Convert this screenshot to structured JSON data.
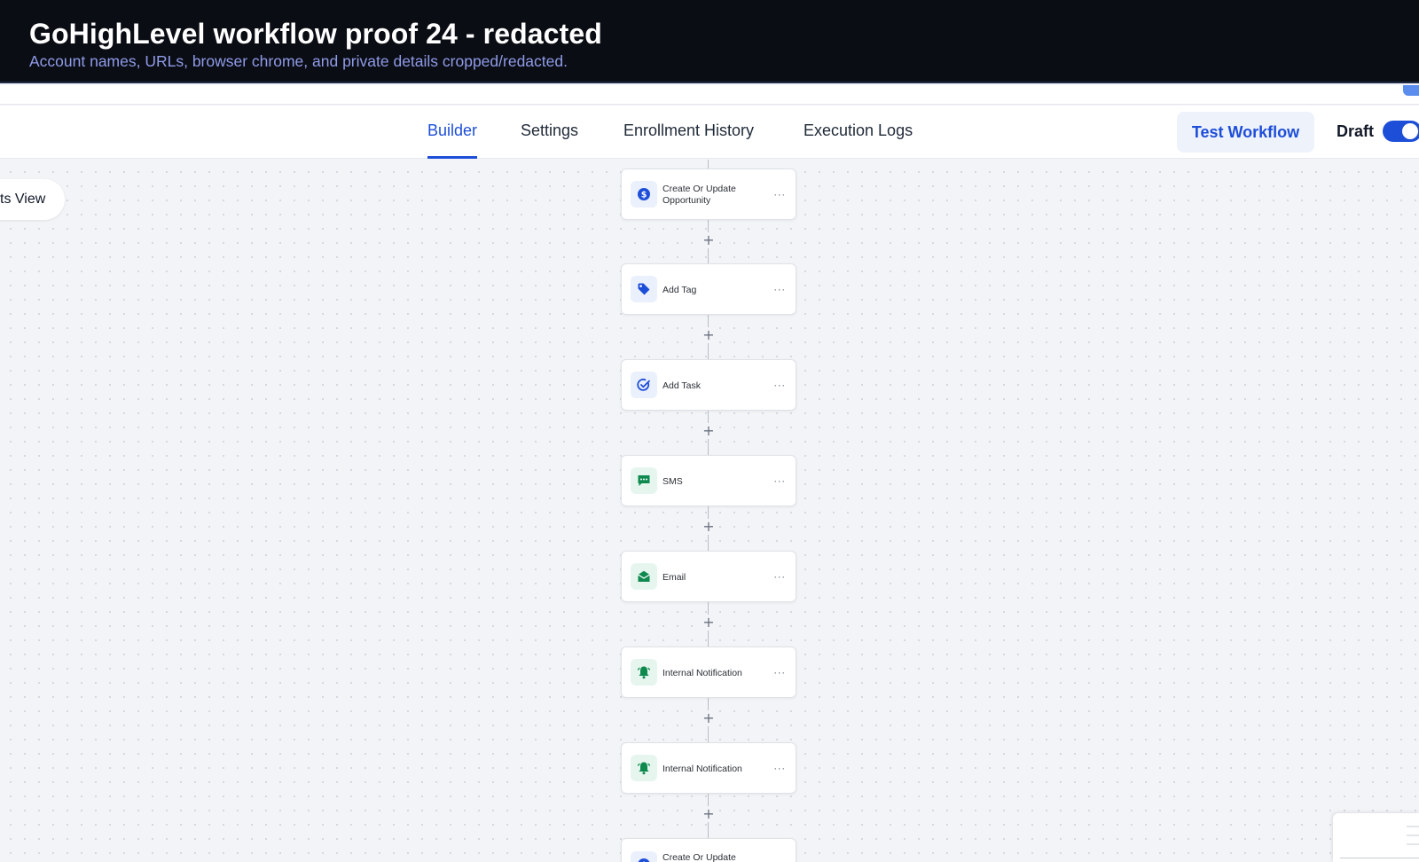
{
  "banner": {
    "title": "GoHighLevel workflow proof 24 - redacted",
    "subtitle": "Account names, URLs, browser chrome, and private details cropped/redacted."
  },
  "tabs": {
    "builder": "Builder",
    "settings": "Settings",
    "enrollment": "Enrollment History",
    "logs": "Execution Logs",
    "active": "Builder"
  },
  "toolbar": {
    "test_workflow": "Test Workflow",
    "status_label": "Draft",
    "status_toggle_on": true
  },
  "canvas": {
    "view_pill": "ts View",
    "add_step_symbol": "+",
    "node_menu_symbol": "···",
    "nodes": [
      {
        "label": "Create Or Update Opportunity",
        "icon": "dollar-icon",
        "color": "#1d4ed8"
      },
      {
        "label": "Add Tag",
        "icon": "tag-icon",
        "color": "#1d4ed8"
      },
      {
        "label": "Add Task",
        "icon": "task-check-icon",
        "color": "#1d4ed8"
      },
      {
        "label": "SMS",
        "icon": "sms-icon",
        "color": "#0f8a4f"
      },
      {
        "label": "Email",
        "icon": "email-icon",
        "color": "#0f8a4f"
      },
      {
        "label": "Internal Notification",
        "icon": "bell-icon",
        "color": "#0f8a4f"
      },
      {
        "label": "Internal Notification",
        "icon": "bell-icon",
        "color": "#0f8a4f"
      },
      {
        "label": "Create Or Update",
        "icon": "dollar-icon",
        "color": "#1d4ed8"
      }
    ]
  },
  "colors": {
    "accent": "#1d4ed8",
    "banner_bg": "#0b0d14",
    "banner_subtitle": "#8f9be8"
  }
}
